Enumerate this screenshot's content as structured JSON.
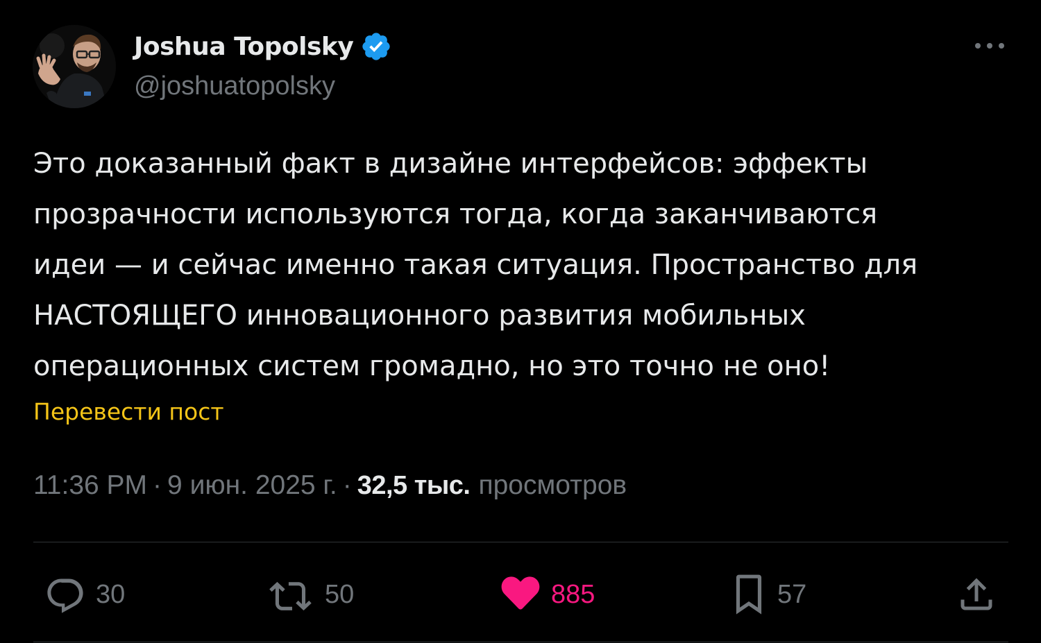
{
  "author": {
    "name": "Joshua Topolsky",
    "handle": "@joshuatopolsky",
    "verified": true
  },
  "tweet": {
    "lines": [
      "Это доказанный факт в дизайне интерфейсов: эффекты",
      "прозрачности используются тогда, когда заканчиваются",
      "идеи — и сейчас именно такая ситуация. Пространство для",
      "НАСТОЯЩЕГО инновационного развития мобильных",
      "операционных систем громадно, но это точно не оно!"
    ],
    "translate_label": "Перевести пост"
  },
  "meta": {
    "time": "11:36 PM",
    "separator": "·",
    "date": "9 июн. 2025 г.",
    "views_count": "32,5 тыс.",
    "views_label": "просмотров"
  },
  "actions": {
    "replies": "30",
    "reposts": "50",
    "likes": "885",
    "bookmarks": "57"
  },
  "colors": {
    "background": "#000000",
    "text": "#e7e9ea",
    "secondary": "#71767b",
    "verified": "#1d9bf0",
    "translate": "#f5c518",
    "like": "#f91880",
    "divider": "#2f3336"
  },
  "icons": {
    "more": "more-dots-icon",
    "reply": "reply-bubble-icon",
    "repost": "repost-arrows-icon",
    "like": "heart-filled-icon",
    "bookmark": "bookmark-icon",
    "share": "share-upload-icon",
    "verified": "verified-badge-icon"
  }
}
